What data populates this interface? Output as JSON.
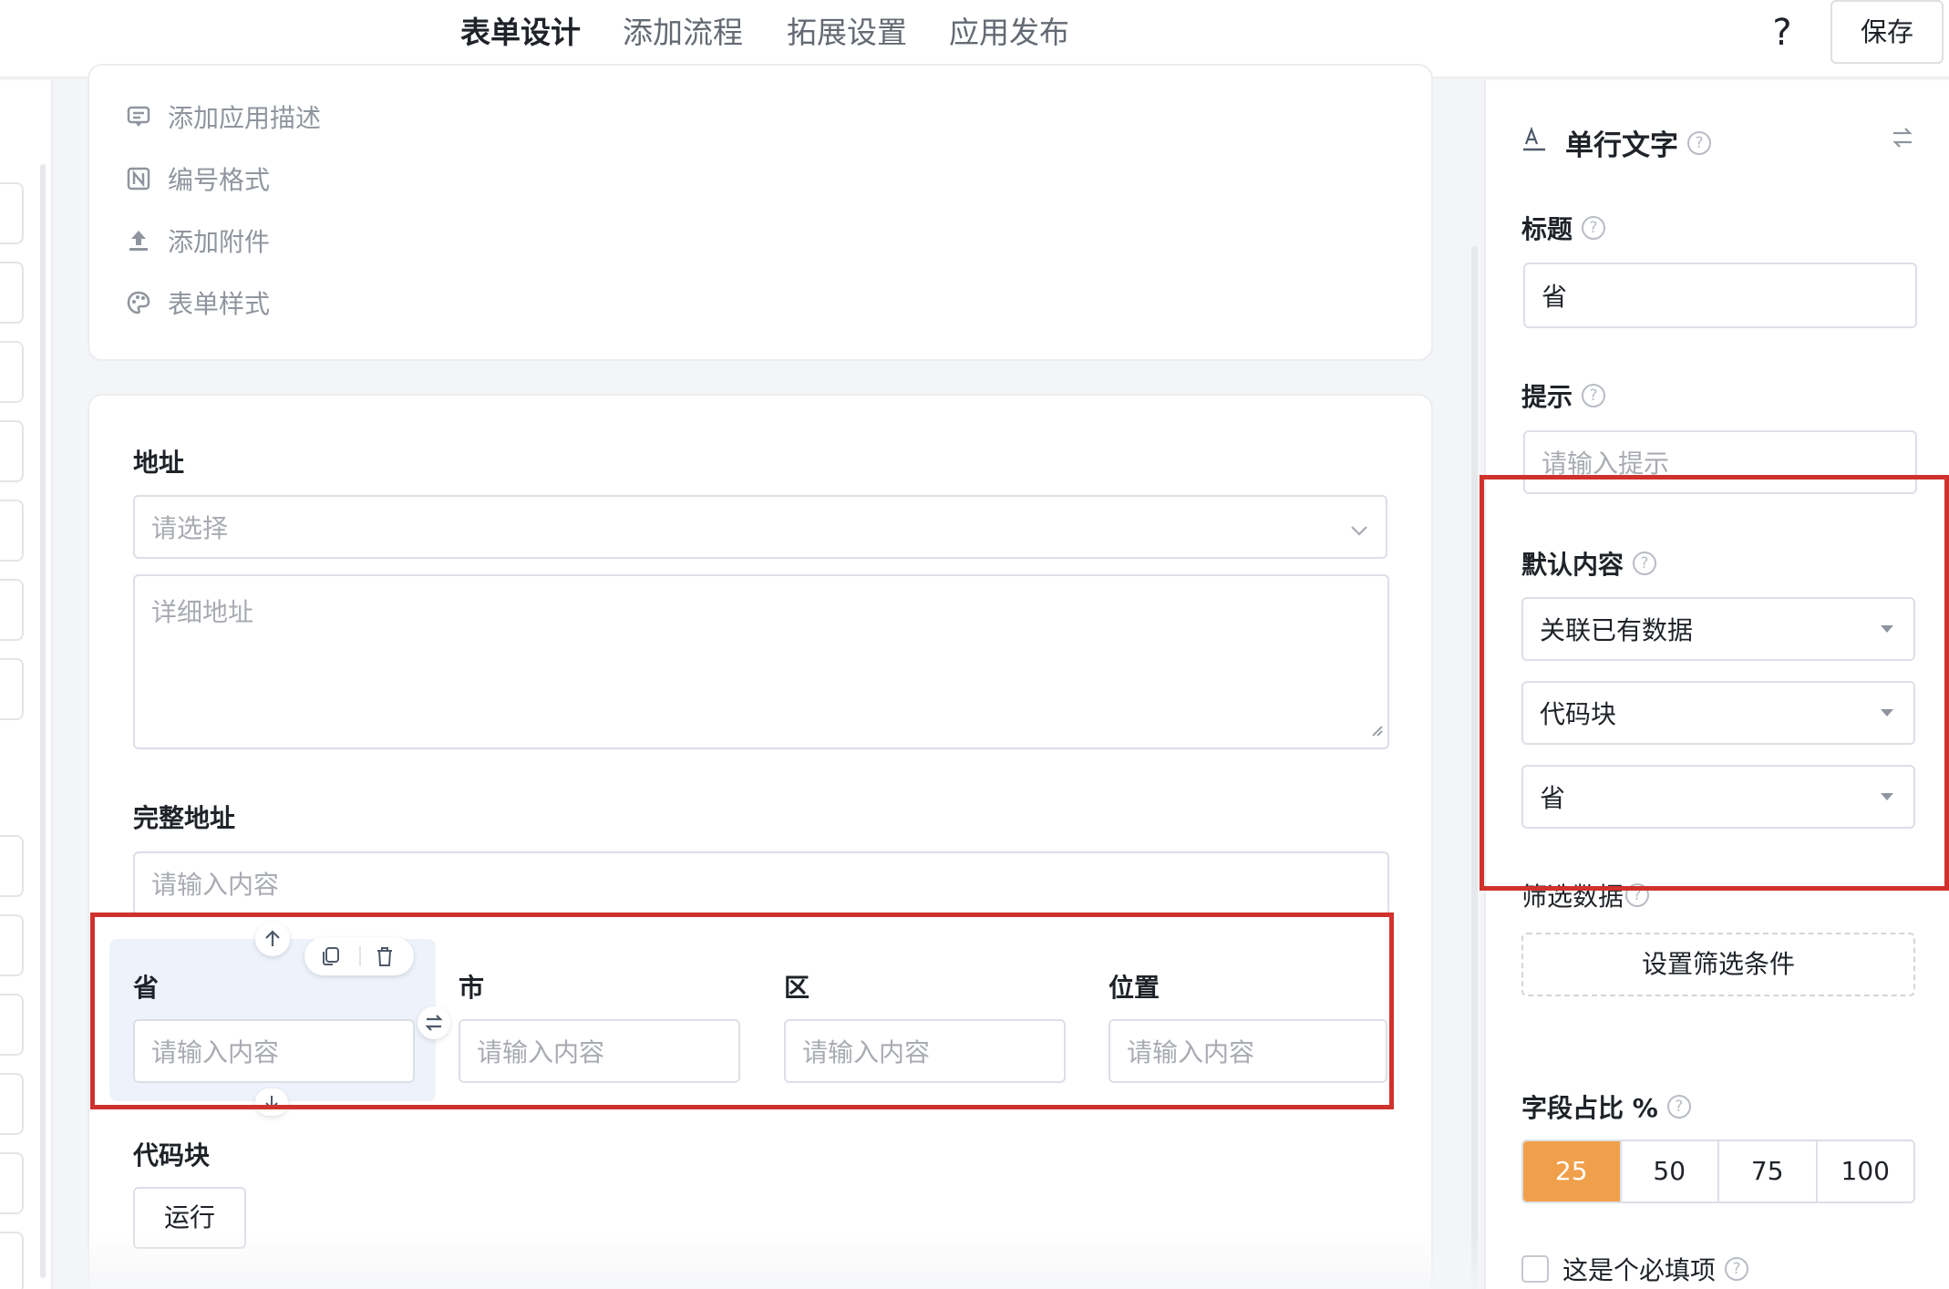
{
  "header": {
    "tabs": [
      {
        "label": "表单设计"
      },
      {
        "label": "添加流程"
      },
      {
        "label": "拓展设置"
      },
      {
        "label": "应用发布"
      }
    ],
    "help_label": "?",
    "save_label": "保存"
  },
  "form_settings": {
    "items": [
      {
        "label": "添加应用描述",
        "icon": "comment-icon"
      },
      {
        "label": "编号格式",
        "icon": "number-format-icon"
      },
      {
        "label": "添加附件",
        "icon": "upload-icon"
      },
      {
        "label": "表单样式",
        "icon": "palette-icon"
      }
    ]
  },
  "form": {
    "address": {
      "label": "地址",
      "select_placeholder": "请选择",
      "detail_placeholder": "详细地址"
    },
    "full_address": {
      "label": "完整地址",
      "placeholder": "请输入内容"
    },
    "row_fields": [
      {
        "label": "省",
        "placeholder": "请输入内容"
      },
      {
        "label": "市",
        "placeholder": "请输入内容"
      },
      {
        "label": "区",
        "placeholder": "请输入内容"
      },
      {
        "label": "位置",
        "placeholder": "请输入内容"
      }
    ],
    "code_block": {
      "label": "代码块",
      "run_label": "运行"
    }
  },
  "properties": {
    "field_type": "单行文字",
    "title_label": "标题",
    "title_value": "省",
    "hint_label": "提示",
    "hint_placeholder": "请输入提示",
    "default_label": "默认内容",
    "default_source": "关联已有数据",
    "default_form": "代码块",
    "default_field": "省",
    "filter_label": "筛选数据",
    "filter_button": "设置筛选条件",
    "width_label": "字段占比 %",
    "width_options": [
      "25",
      "50",
      "75",
      "100"
    ],
    "width_selected": "25",
    "required_label": "这是个必填项"
  },
  "colors": {
    "accent": "#f0a04b",
    "highlight_border": "#d0312d",
    "selected_field_bg": "#eef2fb"
  }
}
